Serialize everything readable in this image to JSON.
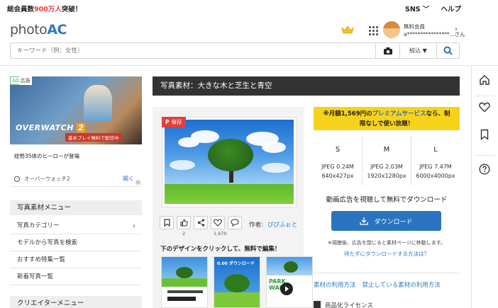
{
  "header": {
    "members_prefix": "総会員数",
    "members_count": "900万人",
    "members_suffix": "突破！",
    "sns_label": "SNS",
    "help_label": "ヘルプ",
    "logo_photo": "photo",
    "logo_ac": "AC",
    "user_plan": "無料会員",
    "user_name": "a****************...さん"
  },
  "search": {
    "placeholder": "キーワード（例：女性）",
    "sort_label": "絞込 ▼"
  },
  "ad": {
    "tag": "AD",
    "tag_ja": "広告",
    "game_title": "OVERWATCH",
    "game_num": "2",
    "banner_text": "基本プレイ無料で配信中",
    "headline": "総勢35体のヒーローが登場",
    "source": "オーバーウォッチ2",
    "open_label": "開く"
  },
  "left_menu": {
    "heading": "写真素材メニュー",
    "items": [
      {
        "label": "写真カテゴリー"
      },
      {
        "label": "モデルから写真を検索"
      },
      {
        "label": "おすすめ特集一覧"
      },
      {
        "label": "新着写真一覧"
      }
    ],
    "heading2": "クリエイターメニュー"
  },
  "main": {
    "title": "写真素材：大きな木と芝生と青空",
    "save_label": "保存",
    "like_count": "2",
    "fav_count": "1,670",
    "author_label": "作者:",
    "author_name": "ぴぴふぉと",
    "design_heading": "下のデザインをクリックして、無料で編集！",
    "thumb2_text": "0.00 ダウンロード",
    "thumb3_text": "PARK WALK"
  },
  "download": {
    "promo_prefix": "※月額1,569円の",
    "promo_premium": "プレミアムサービス",
    "promo_suffix_1": "なら、制",
    "promo_line2": "限なしで使い放題！",
    "sizes": [
      {
        "letter": "S",
        "format": "JPEG 0.24M",
        "dims": "640x427px"
      },
      {
        "letter": "M",
        "format": "JPEG 2.03M",
        "dims": "1920x1280px"
      },
      {
        "letter": "L",
        "format": "JPEG 7.47M",
        "dims": "6000x4000px"
      }
    ],
    "cta_text": "動画広告を視聴して無料でダウンロード",
    "button_label": "ダウンロード",
    "note": "※視聴後、広告を閉じると素材ページに移動します。",
    "wait_link": "待たずにダウンロードする方法は？",
    "link_usage": "素材の利用方法",
    "link_prohibited": "禁止している素材の利用方法",
    "license_label": "商品化ライセンス"
  },
  "colors": {
    "accent_blue": "#2a74bf",
    "promo_yellow": "#f7d21a",
    "title_bar": "#333333",
    "save_red": "#e23f3f"
  }
}
